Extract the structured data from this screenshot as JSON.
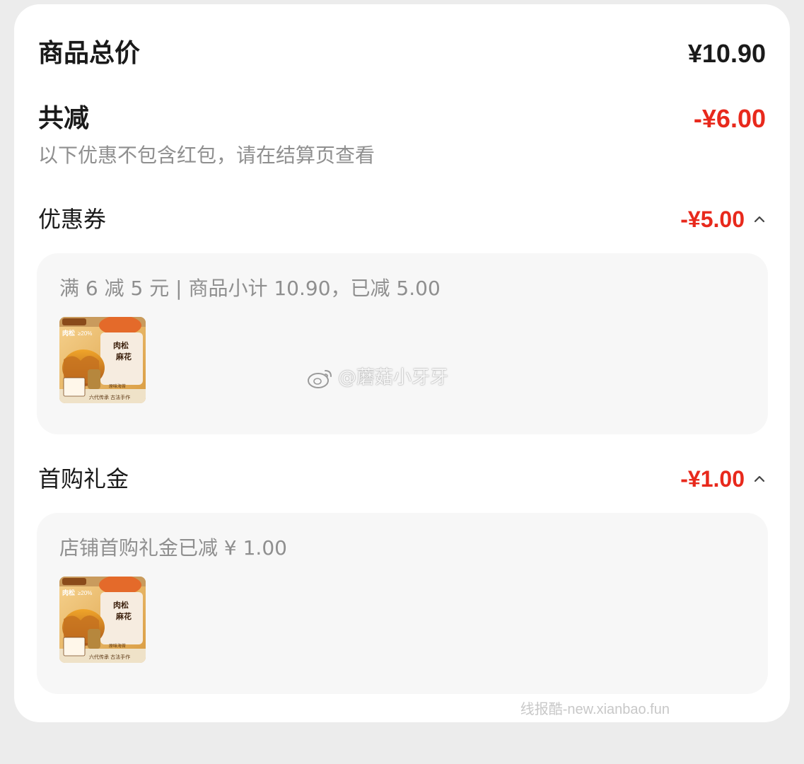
{
  "summary": {
    "total_label": "商品总价",
    "total_value": "¥10.90",
    "discount_label": "共减",
    "discount_value": "-¥6.00",
    "note": "以下优惠不包含红包，请在结算页查看"
  },
  "sections": [
    {
      "label": "优惠券",
      "value": "-¥5.00",
      "detail": "满 6 减 5 元 | 商品小计 10.90，已减 5.00",
      "chevron": "chevron-up-icon",
      "thumb": {
        "brand": "莫二嫂",
        "headline": "肉松",
        "badge": "≥20%",
        "title": "肉松麻花",
        "tag": "原味海苔",
        "footer": "六代传承 古法手作"
      }
    },
    {
      "label": "首购礼金",
      "value": "-¥1.00",
      "detail": "店铺首购礼金已减 ¥ 1.00",
      "chevron": "chevron-up-icon",
      "thumb": {
        "brand": "莫二嫂",
        "headline": "肉松",
        "badge": "≥20%",
        "title": "肉松麻花",
        "tag": "原味海苔",
        "footer": "六代传承 古法手作"
      }
    }
  ],
  "watermarks": {
    "weibo": "@蘑菇小牙牙",
    "site": "线报酷-new.xianbao.fun"
  },
  "colors": {
    "accent_red": "#e8291c",
    "text_primary": "#1a1a1a",
    "text_secondary": "#8f8f8f",
    "panel_bg": "#f7f7f7",
    "card_bg": "#ffffff",
    "page_bg": "#ececec"
  }
}
